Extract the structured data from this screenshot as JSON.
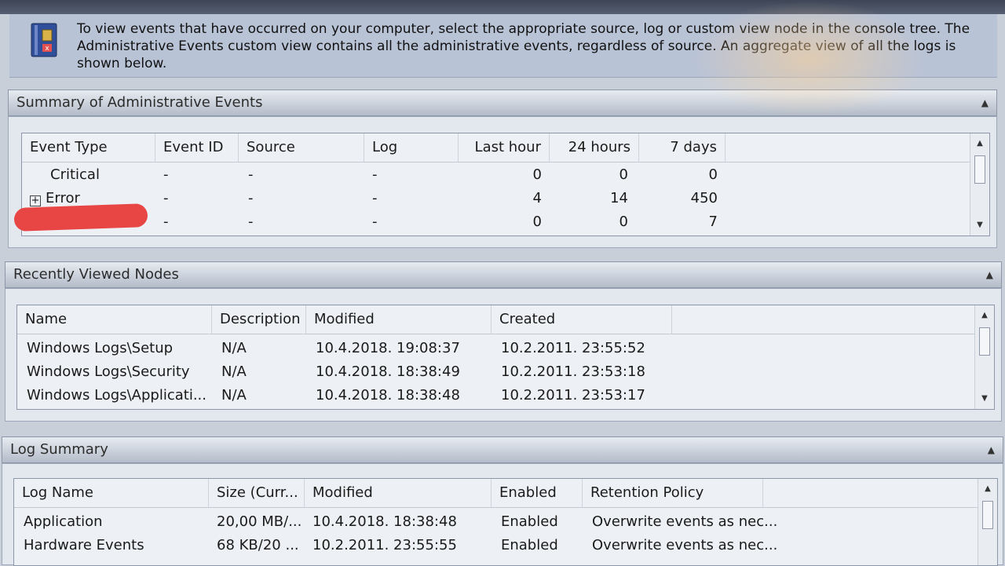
{
  "intro": {
    "text": "To view events that have occurred on your computer, select the appropriate source, log or custom view node in the console tree. The Administrative Events custom view contains all the administrative events, regardless of source. An aggregate view of all the logs is shown below."
  },
  "summary": {
    "title": "Summary of Administrative Events",
    "columns": [
      "Event Type",
      "Event ID",
      "Source",
      "Log",
      "Last hour",
      "24 hours",
      "7 days"
    ],
    "rows": [
      {
        "type": "Critical",
        "event_id": "-",
        "source": "-",
        "log": "-",
        "last_hour": "0",
        "h24": "0",
        "d7": "0"
      },
      {
        "type": "Error",
        "event_id": "-",
        "source": "-",
        "log": "-",
        "last_hour": "4",
        "h24": "14",
        "d7": "450"
      },
      {
        "type": "",
        "event_id": "-",
        "source": "-",
        "log": "-",
        "last_hour": "0",
        "h24": "0",
        "d7": "7"
      }
    ]
  },
  "recent": {
    "title": "Recently Viewed Nodes",
    "columns": [
      "Name",
      "Description",
      "Modified",
      "Created"
    ],
    "rows": [
      {
        "name": "Windows Logs\\Setup",
        "description": "N/A",
        "modified": "10.4.2018. 19:08:37",
        "created": "10.2.2011. 23:55:52"
      },
      {
        "name": "Windows Logs\\Security",
        "description": "N/A",
        "modified": "10.4.2018. 18:38:49",
        "created": "10.2.2011. 23:53:18"
      },
      {
        "name": "Windows Logs\\Applicati...",
        "description": "N/A",
        "modified": "10.4.2018. 18:38:48",
        "created": "10.2.2011. 23:53:17"
      }
    ]
  },
  "logsummary": {
    "title": "Log Summary",
    "columns": [
      "Log Name",
      "Size (Curr...",
      "Modified",
      "Enabled",
      "Retention Policy"
    ],
    "rows": [
      {
        "name": "Application",
        "size": "20,00 MB/...",
        "modified": "10.4.2018. 18:38:48",
        "enabled": "Enabled",
        "retention": "Overwrite events as nec..."
      },
      {
        "name": "Hardware Events",
        "size": "68 KB/20 ...",
        "modified": "10.2.2011. 23:55:55",
        "enabled": "Enabled",
        "retention": "Overwrite events as nec..."
      }
    ]
  }
}
